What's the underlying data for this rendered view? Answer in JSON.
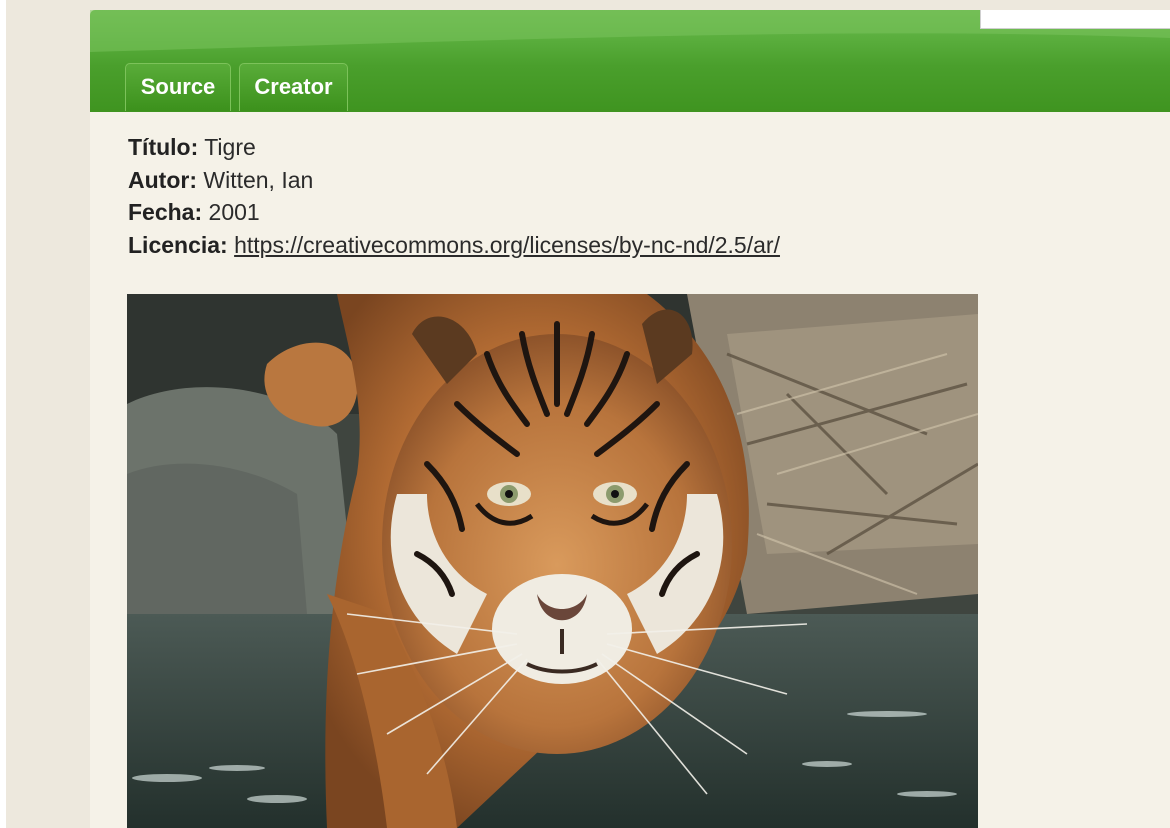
{
  "tabs": [
    {
      "label": "Source"
    },
    {
      "label": "Creator"
    }
  ],
  "record": {
    "title_label": "Título:",
    "title_value": "Tigre",
    "author_label": "Autor:",
    "author_value": "Witten, Ian",
    "date_label": "Fecha:",
    "date_value": "2001",
    "license_label": "Licencia:",
    "license_value": "https://creativecommons.org/licenses/by-nc-nd/2.5/ar/"
  },
  "colors": {
    "header_green": "#4a9f2c",
    "tab_green": "#3c911c",
    "panel_bg": "#f5f2e8",
    "page_bg": "#ede8dd"
  }
}
